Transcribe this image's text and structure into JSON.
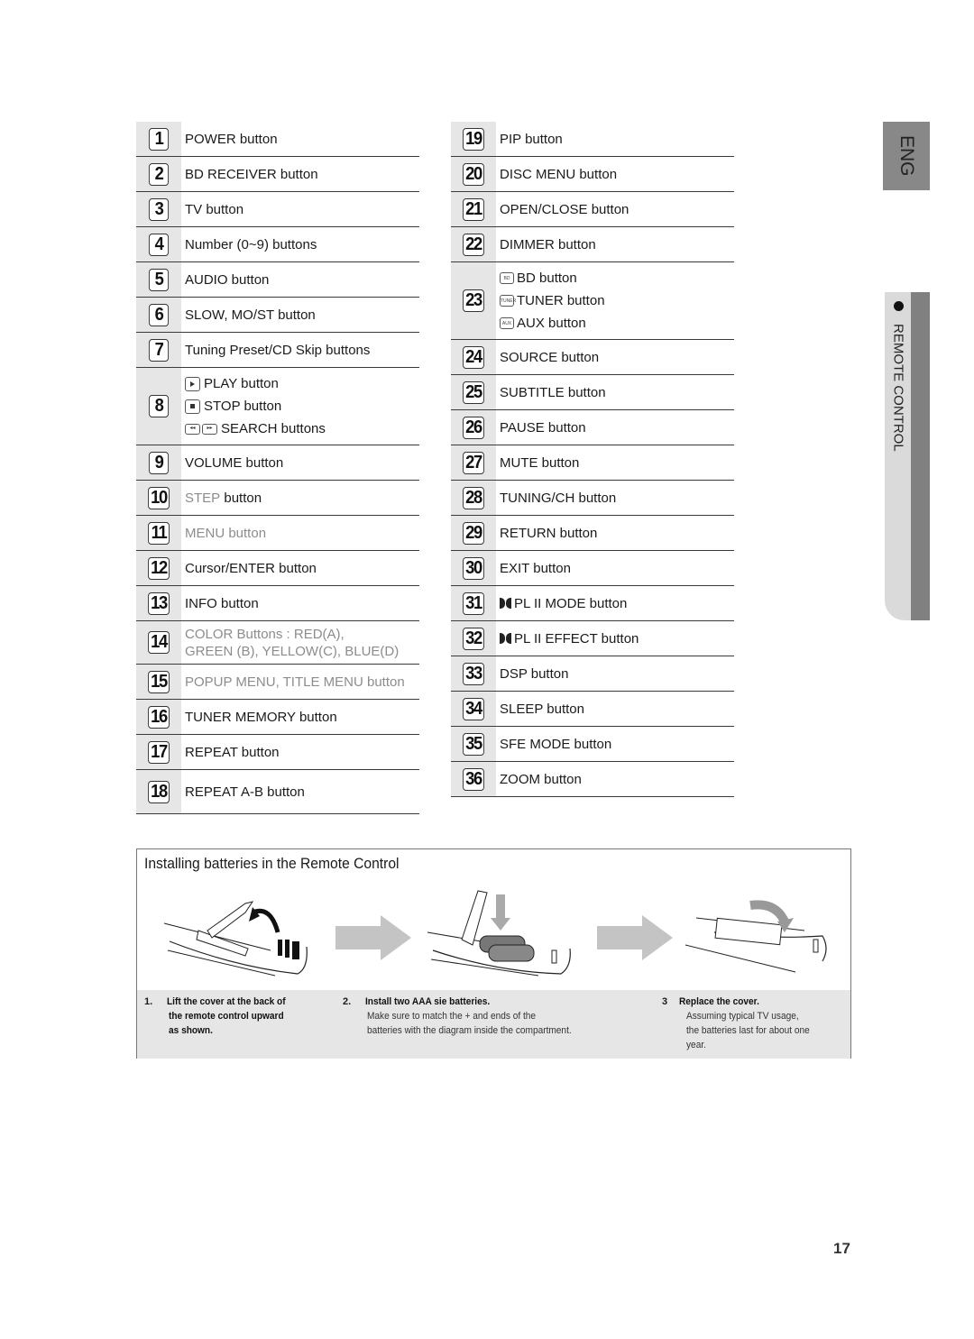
{
  "side_tabs": {
    "language": "ENG",
    "section": "REMOTE CONTROL"
  },
  "left_column": [
    {
      "num": "1",
      "lines": [
        {
          "text": "POWER button"
        }
      ]
    },
    {
      "num": "2",
      "lines": [
        {
          "text": "BD RECEIVER button"
        }
      ]
    },
    {
      "num": "3",
      "lines": [
        {
          "text": "TV button"
        }
      ]
    },
    {
      "num": "4",
      "lines": [
        {
          "text": "Number (0~9) buttons"
        }
      ]
    },
    {
      "num": "5",
      "lines": [
        {
          "text": "AUDIO button"
        }
      ]
    },
    {
      "num": "6",
      "lines": [
        {
          "text": "SLOW, MO/ST button"
        }
      ]
    },
    {
      "num": "7",
      "lines": [
        {
          "text": "Tuning Preset/CD Skip buttons"
        }
      ]
    },
    {
      "num": "8",
      "lines": [
        {
          "icon": "play-button-icon",
          "icon_label": "PLAY",
          "text": "PLAY button"
        },
        {
          "icon": "stop-button-icon",
          "icon_label": "STOP",
          "text": "STOP button"
        },
        {
          "icon": "search-buttons-icon",
          "icon_label": "◂◂ ▸▸",
          "text": "SEARCH buttons"
        }
      ]
    },
    {
      "num": "9",
      "lines": [
        {
          "text": "VOLUME button"
        }
      ]
    },
    {
      "num": "10",
      "lines": [
        {
          "grey": "STEP",
          "text": " button"
        }
      ]
    },
    {
      "num": "11",
      "lines": [
        {
          "grey": "MENU button",
          "text": ""
        }
      ]
    },
    {
      "num": "12",
      "lines": [
        {
          "text": "Cursor/ENTER button"
        }
      ]
    },
    {
      "num": "13",
      "lines": [
        {
          "text": "INFO button"
        }
      ]
    },
    {
      "num": "14",
      "lines": [
        {
          "grey": "COLOR Buttons : RED(A),",
          "text": ""
        },
        {
          "grey": "GREEN (B), YELLOW(C), BLUE(D)",
          "text": ""
        }
      ]
    },
    {
      "num": "15",
      "lines": [
        {
          "grey": "POPUP MENU, TITLE MENU button",
          "text": ""
        }
      ]
    },
    {
      "num": "16",
      "lines": [
        {
          "text": "TUNER MEMORY button"
        }
      ]
    },
    {
      "num": "17",
      "lines": [
        {
          "text": "REPEAT button"
        }
      ]
    },
    {
      "num": "18",
      "lines": [
        {
          "text": "REPEAT A-B button"
        }
      ]
    }
  ],
  "right_column": [
    {
      "num": "19",
      "lines": [
        {
          "text": "PIP button"
        }
      ]
    },
    {
      "num": "20",
      "lines": [
        {
          "text": "DISC MENU button"
        }
      ]
    },
    {
      "num": "21",
      "lines": [
        {
          "text": "OPEN/CLOSE button"
        }
      ]
    },
    {
      "num": "22",
      "lines": [
        {
          "text": "DIMMER button"
        }
      ]
    },
    {
      "num": "23",
      "lines": [
        {
          "icon": "bd-button-icon",
          "icon_label": "BD",
          "text": "BD button"
        },
        {
          "icon": "tuner-button-icon",
          "icon_label": "TUNER",
          "text": "TUNER button"
        },
        {
          "icon": "aux-button-icon",
          "icon_label": "AUX",
          "text": "AUX button"
        }
      ]
    },
    {
      "num": "24",
      "lines": [
        {
          "text": "SOURCE button"
        }
      ]
    },
    {
      "num": "25",
      "lines": [
        {
          "text": "SUBTITLE button"
        }
      ]
    },
    {
      "num": "26",
      "lines": [
        {
          "text": "PAUSE button"
        }
      ]
    },
    {
      "num": "27",
      "lines": [
        {
          "text": "MUTE button"
        }
      ]
    },
    {
      "num": "28",
      "lines": [
        {
          "text": "TUNING/CH button"
        }
      ]
    },
    {
      "num": "29",
      "lines": [
        {
          "text": "RETURN button"
        }
      ]
    },
    {
      "num": "30",
      "lines": [
        {
          "text": "EXIT button"
        }
      ]
    },
    {
      "num": "31",
      "lines": [
        {
          "icon": "dolby-icon",
          "text": "PL II MODE button"
        }
      ]
    },
    {
      "num": "32",
      "lines": [
        {
          "icon": "dolby-icon",
          "text": "PL II EFFECT button"
        }
      ]
    },
    {
      "num": "33",
      "lines": [
        {
          "text": "DSP button"
        }
      ]
    },
    {
      "num": "34",
      "lines": [
        {
          "text": "SLEEP button"
        }
      ]
    },
    {
      "num": "35",
      "lines": [
        {
          "text": "SFE MODE button"
        }
      ]
    },
    {
      "num": "36",
      "lines": [
        {
          "text": "ZOOM button"
        }
      ]
    }
  ],
  "battery": {
    "title": "Installing batteries in the Remote Control",
    "steps": [
      {
        "num": "1.",
        "head": [
          "Lift the cover at the back of",
          "the remote control upward",
          "as shown."
        ],
        "body": []
      },
      {
        "num": "2.",
        "head": [
          "Install two AAA sie batteries."
        ],
        "body": [
          "Make sure to match the + and  ends of the",
          "batteries with the diagram inside the compartment."
        ]
      },
      {
        "num": "3",
        "head": [
          "Replace the cover."
        ],
        "body": [
          "Assuming typical TV usage,",
          "the batteries last for about one",
          "year."
        ]
      }
    ]
  },
  "page_number": "17"
}
